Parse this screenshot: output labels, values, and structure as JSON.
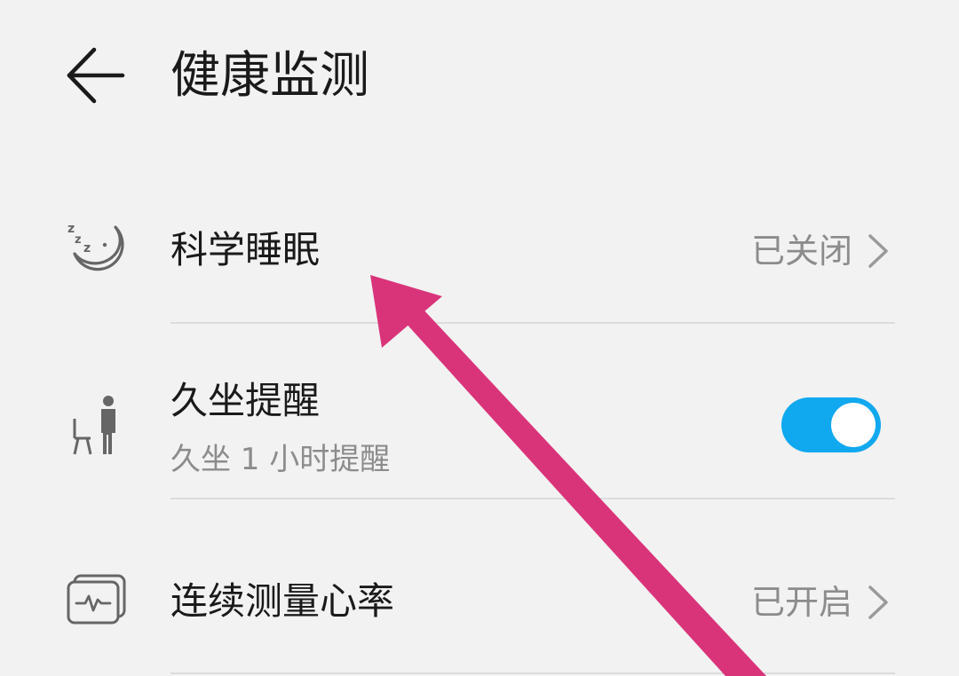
{
  "header": {
    "back_icon": "arrow-left-icon",
    "title": "健康监测"
  },
  "settings": {
    "sleep": {
      "icon": "sleep-moon-icon",
      "label": "科学睡眠",
      "status": "已关闭"
    },
    "sedentary": {
      "icon": "person-sitting-icon",
      "label": "久坐提醒",
      "subtitle": "久坐 1 小时提醒",
      "toggle_on": true
    },
    "heart_rate": {
      "icon": "heart-rate-monitor-icon",
      "label": "连续测量心率",
      "status": "已开启"
    }
  },
  "annotation": {
    "arrow_color": "#d9347a"
  },
  "colors": {
    "background": "#f2f2f2",
    "accent": "#10a8ef",
    "secondary_text": "#8c8c8c"
  }
}
